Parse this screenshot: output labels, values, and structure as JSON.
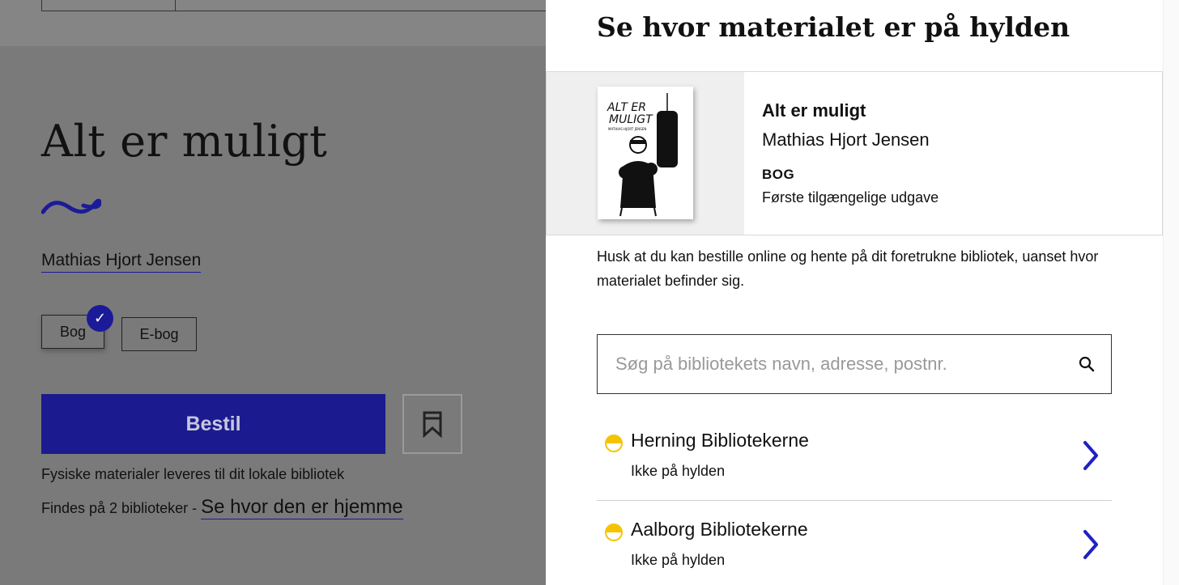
{
  "background_page": {
    "title": "Alt er muligt",
    "author_link": "Mathias Hjort Jensen",
    "formats": [
      {
        "label": "Bog",
        "selected": true
      },
      {
        "label": "E-bog",
        "selected": false
      }
    ],
    "order_button": "Bestil",
    "delivery_note": "Fysiske materialer leveres til dit lokale bibliotek",
    "found_prefix": "Findes på 2 biblioteker - ",
    "found_link": "Se hvor den er hjemme"
  },
  "panel": {
    "title": "Se hvor materialet er på hylden",
    "material": {
      "title": "Alt er muligt",
      "author": "Mathias Hjort Jensen",
      "type": "BOG",
      "edition": "Første tilgængelige udgave",
      "cover": {
        "title_line1": "ALT ER",
        "title_line2": "MULIGT",
        "author": "MATHIAS HJORT JENSEN"
      }
    },
    "note": "Husk at du kan bestille online og hente på dit foretrukne bibliotek, uanset hvor materialet befinder sig.",
    "search": {
      "placeholder": "Søg på bibliotekets navn, adresse, postnr.",
      "value": ""
    },
    "libraries": [
      {
        "name": "Herning Bibliotekerne",
        "status": "Ikke på hylden",
        "status_color": "#f5c400"
      },
      {
        "name": "Aalborg Bibliotekerne",
        "status": "Ikke på hylden",
        "status_color": "#f5c400"
      }
    ]
  },
  "colors": {
    "accent": "#2020c8",
    "overlay": "#7a7a7a"
  },
  "icons": [
    "check-icon",
    "bookmark-icon",
    "search-icon",
    "chevron-right-icon",
    "status-half-icon",
    "squiggle-icon"
  ]
}
